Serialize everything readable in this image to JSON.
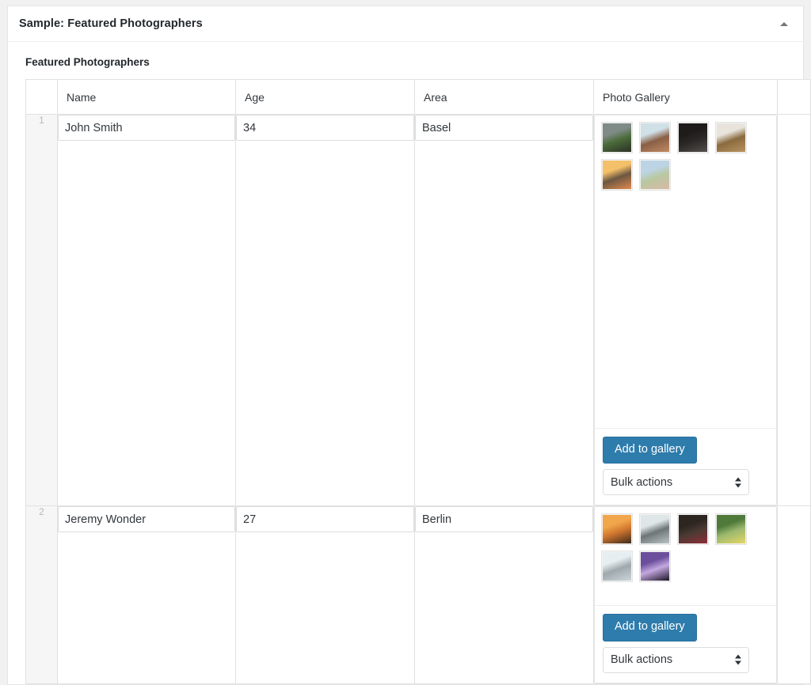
{
  "panel": {
    "title": "Sample: Featured Photographers",
    "toggle_icon": "caret-up-icon"
  },
  "section": {
    "heading": "Featured Photographers"
  },
  "table": {
    "columns": [
      "",
      "Name",
      "Age",
      "Area",
      "Photo Gallery",
      ""
    ],
    "rows": [
      {
        "number": "1",
        "name": "John Smith",
        "age": "34",
        "area": "Basel",
        "gallery": {
          "add_button_label": "Add to gallery",
          "bulk_select_value": "Bulk actions",
          "bulk_select_options": [
            "Bulk actions"
          ],
          "thumbnails": [
            {
              "name": "photo-hands-toast-mountain",
              "c1": "#7e8b86",
              "c2": "#2b3026",
              "c3": "#4b6b3a"
            },
            {
              "name": "photo-couple-desert-road",
              "c1": "#cfe0e6",
              "c2": "#c08a63",
              "c3": "#8a5f45"
            },
            {
              "name": "photo-couple-dark-doorway",
              "c1": "#1e1b1a",
              "c2": "#55504c",
              "c3": "#2a2725"
            },
            {
              "name": "photo-couple-field-embrace",
              "c1": "#e8e4dc",
              "c2": "#b9925f",
              "c3": "#8a6b3f"
            },
            {
              "name": "photo-couple-sunset-beach",
              "c1": "#f4c06a",
              "c2": "#e08a4e",
              "c3": "#6b5741"
            },
            {
              "name": "photo-couple-grass-lying",
              "c1": "#bcd4e4",
              "c2": "#d8b9a6",
              "c3": "#b9c8a0"
            }
          ]
        }
      },
      {
        "number": "2",
        "name": "Jeremy Wonder",
        "age": "27",
        "area": "Berlin",
        "gallery": {
          "add_button_label": "Add to gallery",
          "bulk_select_value": "Bulk actions",
          "bulk_select_options": [
            "Bulk actions"
          ],
          "thumbnails": [
            {
              "name": "photo-woman-sunset-silhouette",
              "c1": "#f2a64b",
              "c2": "#3d2a1c",
              "c3": "#d1762f"
            },
            {
              "name": "photo-person-arms-open-sea",
              "c1": "#dfe6e8",
              "c2": "#b9c3c6",
              "c3": "#6e7577"
            },
            {
              "name": "photo-woman-red-sweater",
              "c1": "#2c2520",
              "c2": "#8d2f37",
              "c3": "#4a3a33"
            },
            {
              "name": "photo-woman-yellow-hat-green",
              "c1": "#4f7a3a",
              "c2": "#e6d766",
              "c3": "#9ab86e"
            },
            {
              "name": "photo-hands-touching-light",
              "c1": "#e7eef2",
              "c2": "#cbd5da",
              "c3": "#9fa9ad"
            },
            {
              "name": "photo-hands-purple-light",
              "c1": "#6b4f9c",
              "c2": "#1b1424",
              "c3": "#c4a8e0"
            }
          ]
        }
      }
    ]
  },
  "colors": {
    "accent": "#2e7cac",
    "page_background": "#f1f1f1",
    "panel_background": "#ffffff",
    "border": "#e5e5e5"
  }
}
